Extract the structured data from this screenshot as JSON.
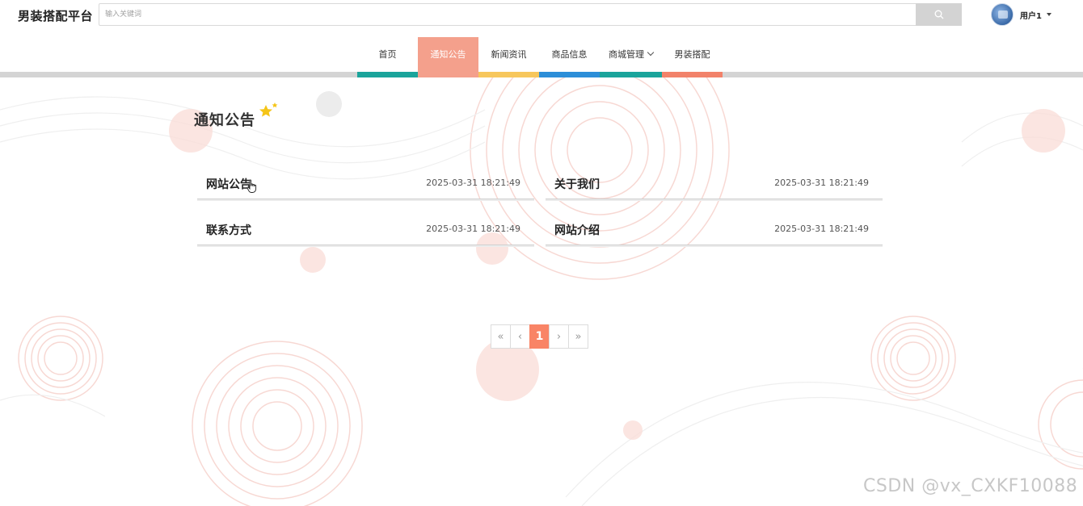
{
  "header": {
    "brand": "男装搭配平台",
    "search": {
      "placeholder": "输入关键词",
      "value": ""
    },
    "user": {
      "name": "用户1"
    }
  },
  "nav": {
    "items": [
      {
        "label": "首页",
        "accent": "#1aa49b",
        "active": false
      },
      {
        "label": "通知公告",
        "accent": "#f4a08c",
        "active": true
      },
      {
        "label": "新闻资讯",
        "accent": "#f7c75c",
        "active": false
      },
      {
        "label": "商品信息",
        "accent": "#2c8ed8",
        "active": false
      },
      {
        "label": "商城管理",
        "accent": "#1aa49b",
        "active": false,
        "has_dropdown": true
      },
      {
        "label": "男装搭配",
        "accent": "#f2826a",
        "active": false
      }
    ]
  },
  "main": {
    "section_title": "通知公告",
    "notices": [
      {
        "title": "网站公告",
        "time": "2025-03-31 18:21:49"
      },
      {
        "title": "关于我们",
        "time": "2025-03-31 18:21:49"
      },
      {
        "title": "联系方式",
        "time": "2025-03-31 18:21:49"
      },
      {
        "title": "网站介绍",
        "time": "2025-03-31 18:21:49"
      }
    ],
    "pagination": {
      "first": "«",
      "prev": "‹",
      "current": "1",
      "next": "›",
      "last": "»"
    }
  },
  "watermark": "CSDN @vx_CXKF10088",
  "colors": {
    "active_page": "#f98466",
    "decoration": "#f6c6c0",
    "star": "#f5c518"
  }
}
